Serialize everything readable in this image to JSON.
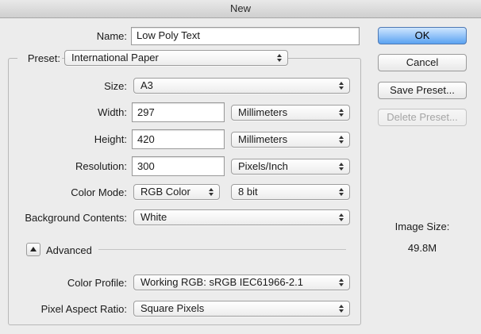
{
  "window": {
    "title": "New"
  },
  "name": {
    "label": "Name:",
    "value": "Low Poly Text"
  },
  "preset": {
    "label": "Preset:",
    "value": "International Paper"
  },
  "size": {
    "label": "Size:",
    "value": "A3"
  },
  "width": {
    "label": "Width:",
    "value": "297",
    "unit": "Millimeters"
  },
  "height": {
    "label": "Height:",
    "value": "420",
    "unit": "Millimeters"
  },
  "resolution": {
    "label": "Resolution:",
    "value": "300",
    "unit": "Pixels/Inch"
  },
  "color_mode": {
    "label": "Color Mode:",
    "value": "RGB Color",
    "depth": "8 bit"
  },
  "background": {
    "label": "Background Contents:",
    "value": "White"
  },
  "advanced": {
    "label": "Advanced"
  },
  "color_profile": {
    "label": "Color Profile:",
    "value": "Working RGB:  sRGB IEC61966-2.1"
  },
  "pixel_aspect": {
    "label": "Pixel Aspect Ratio:",
    "value": "Square Pixels"
  },
  "buttons": {
    "ok": "OK",
    "cancel": "Cancel",
    "save_preset": "Save Preset...",
    "delete_preset": "Delete Preset..."
  },
  "image_size": {
    "label": "Image Size:",
    "value": "49.8M"
  },
  "icons": {
    "popup": "updown-arrows-icon",
    "disclosure": "disclosure-triangle-icon"
  },
  "colors": {
    "accent": "#5aa2f1"
  }
}
